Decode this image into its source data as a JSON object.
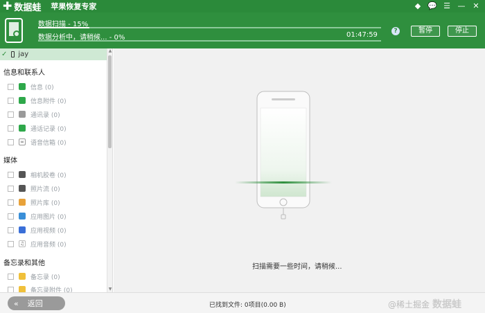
{
  "app": {
    "logo_text": "数据蛙",
    "subtitle": "苹果恢复专家"
  },
  "scan": {
    "line1": "数据扫描 - 15%",
    "line1_progress": 0.15,
    "line2": "数据分析中，请稍候... - 0%",
    "line2_progress": 0.0,
    "time": "01:47:59",
    "help": "?",
    "pause_label": "暂停",
    "stop_label": "停止"
  },
  "sidebar": {
    "device": "jay",
    "sections": [
      {
        "title": "信息和联系人",
        "items": [
          {
            "label": "信息 (0)",
            "icon": "message-icon",
            "color": "#2ea84a"
          },
          {
            "label": "信息附件 (0)",
            "icon": "message-attachment-icon",
            "color": "#2ea84a"
          },
          {
            "label": "通讯录 (0)",
            "icon": "contacts-icon",
            "color": "#9a9a9a"
          },
          {
            "label": "通话记录 (0)",
            "icon": "phone-icon",
            "color": "#2ea84a"
          },
          {
            "label": "语音信箱 (0)",
            "icon": "voicemail-icon",
            "color": "#555555"
          }
        ]
      },
      {
        "title": "媒体",
        "items": [
          {
            "label": "相机胶卷 (0)",
            "icon": "camera-icon",
            "color": "#555555"
          },
          {
            "label": "照片流 (0)",
            "icon": "photo-stream-icon",
            "color": "#555555"
          },
          {
            "label": "照片库 (0)",
            "icon": "photo-library-icon",
            "color": "#e8a23a"
          },
          {
            "label": "应用图片 (0)",
            "icon": "app-image-icon",
            "color": "#3a8fd8"
          },
          {
            "label": "应用视频 (0)",
            "icon": "app-video-icon",
            "color": "#3a6fd8"
          },
          {
            "label": "应用音频 (0)",
            "icon": "app-audio-icon",
            "color": "#777777"
          }
        ]
      },
      {
        "title": "备忘录和其他",
        "items": [
          {
            "label": "备忘录 (0)",
            "icon": "notes-icon",
            "color": "#f0c03a"
          },
          {
            "label": "备忘录附件 (0)",
            "icon": "notes-attachment-icon",
            "color": "#f0c03a"
          }
        ]
      }
    ]
  },
  "main": {
    "message": "扫描需要一些时间，请稍候..."
  },
  "footer": {
    "back_label": "返回",
    "found_text": "已找到文件: 0项目(0.00 B)",
    "watermark": "@稀土掘金",
    "watermark_logo": "数据蛙"
  },
  "colors": {
    "brand_green": "#2f8f3e",
    "selected_row": "#cfe9d4"
  }
}
